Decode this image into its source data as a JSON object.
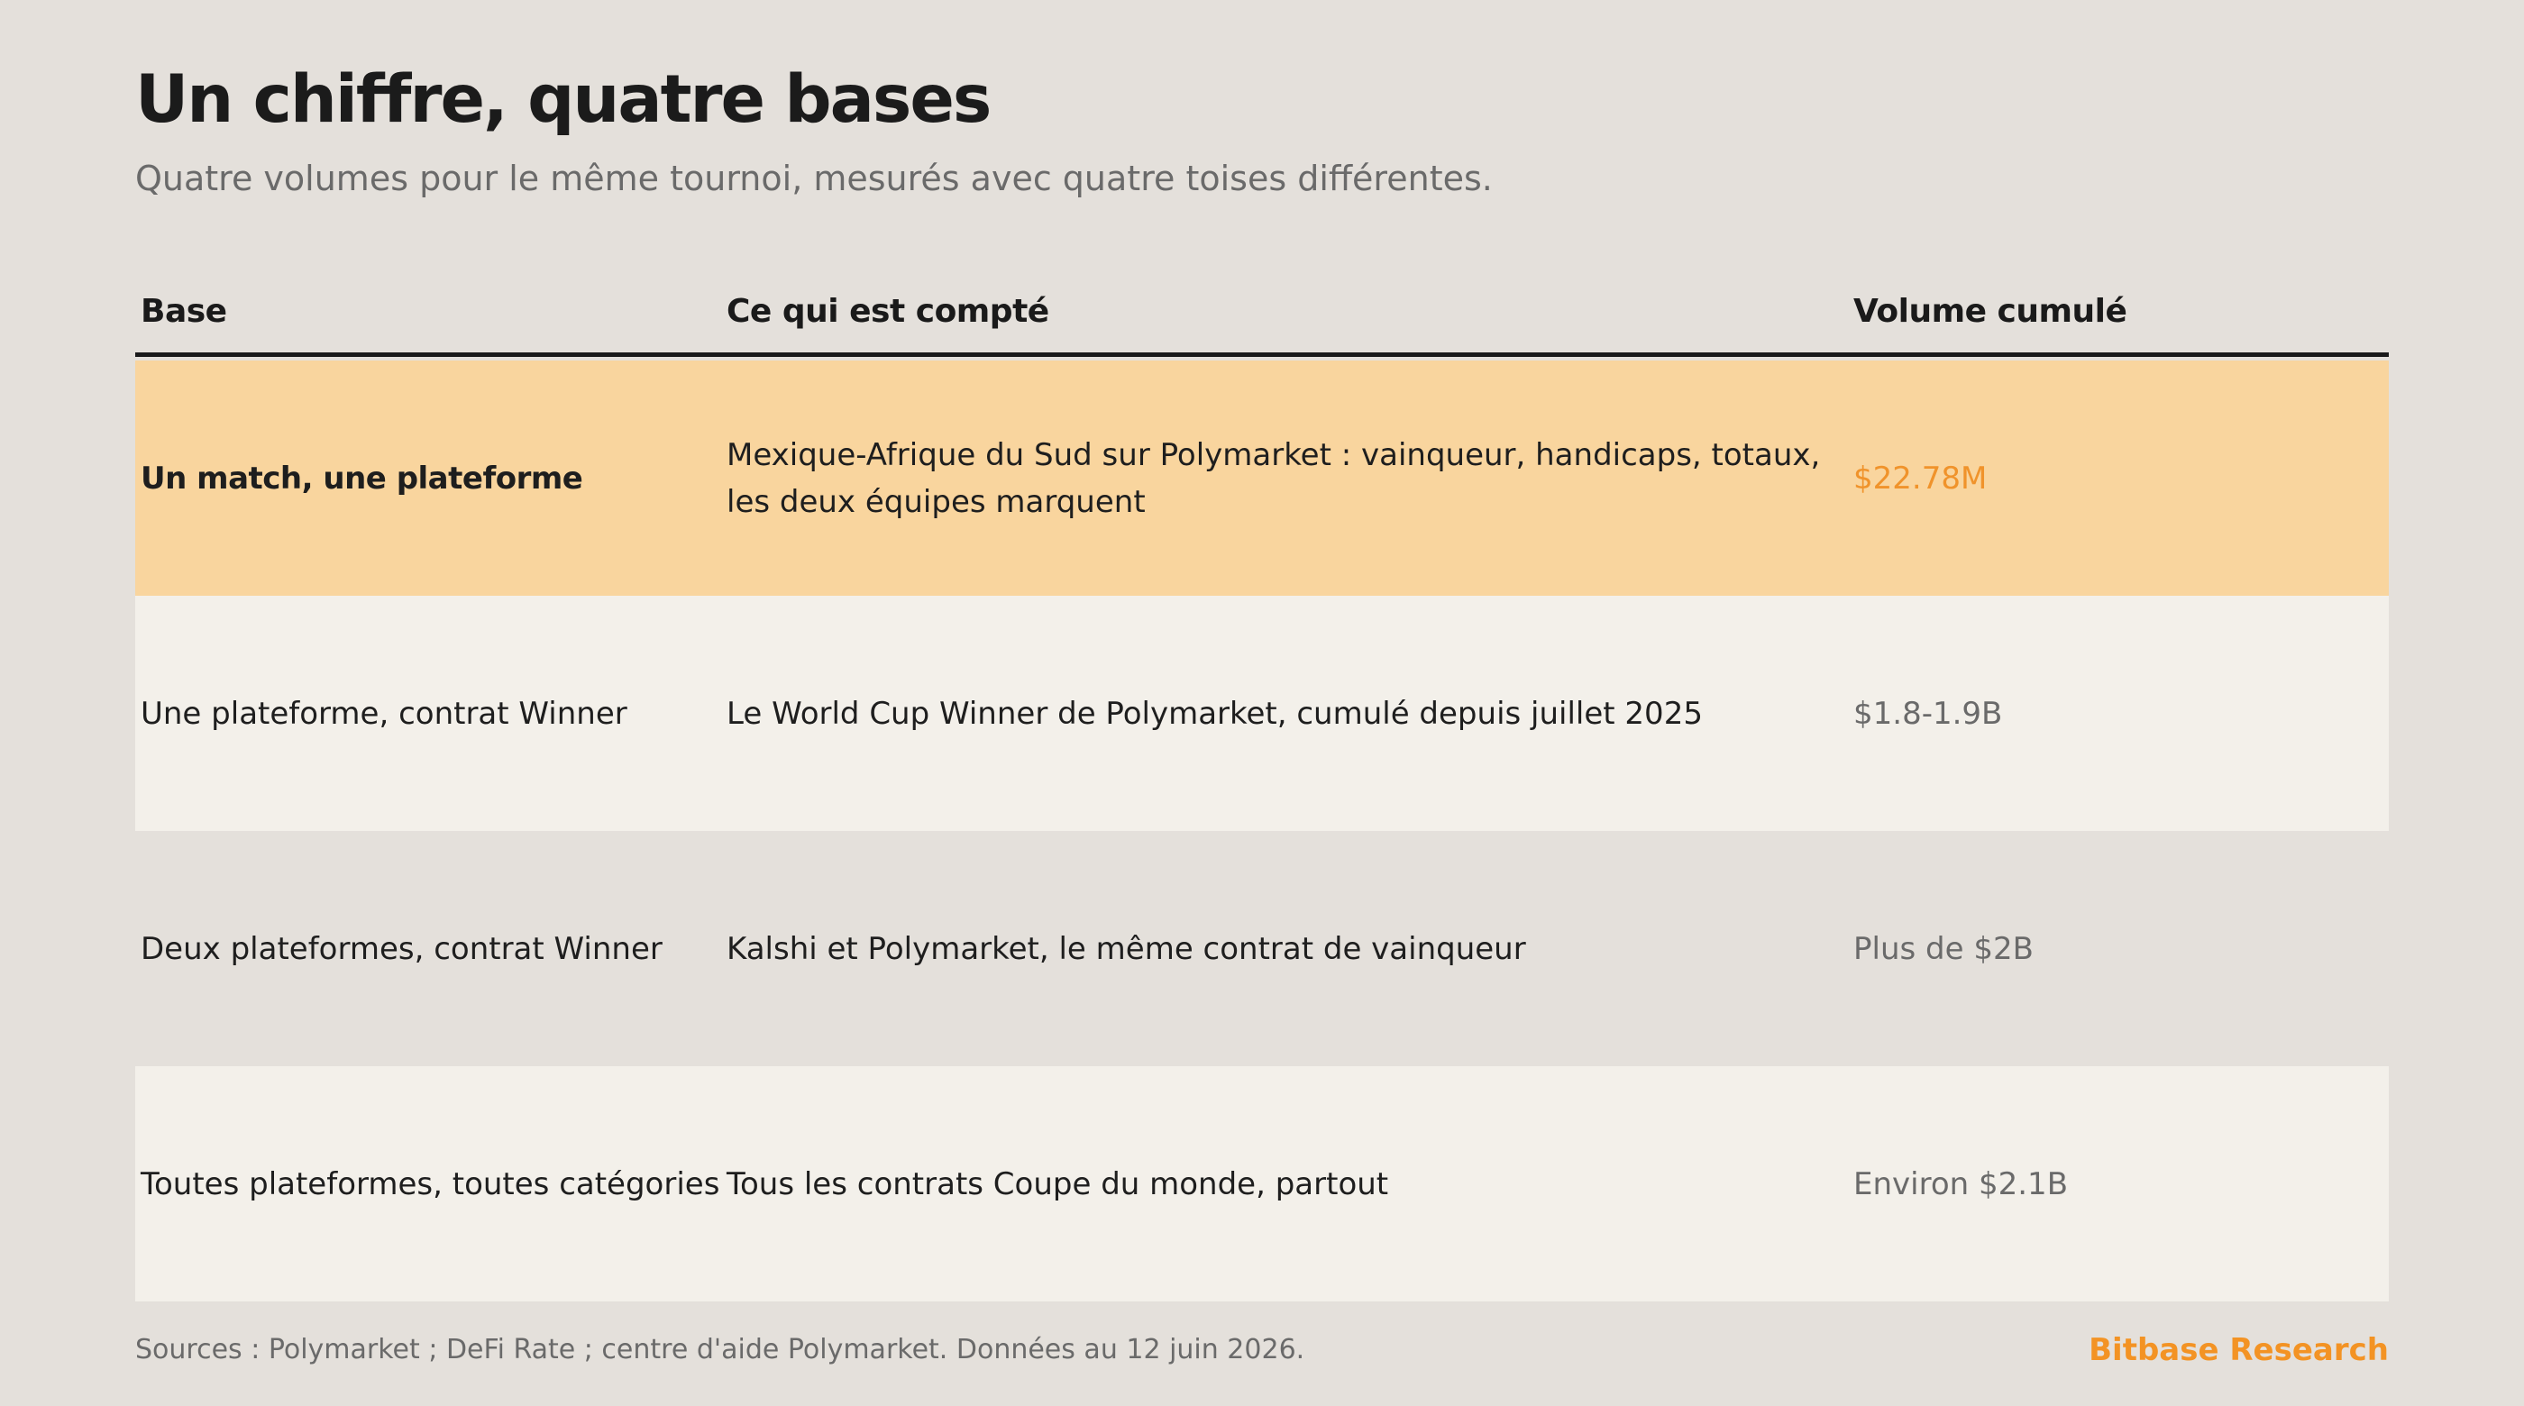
{
  "title": "Un chiffre, quatre bases",
  "subtitle": "Quatre volumes pour le même tournoi, mesurés avec quatre toises différentes.",
  "table": {
    "headers": [
      "Base",
      "Ce qui est compté",
      "Volume cumulé"
    ],
    "rows": [
      {
        "base": "Un match, une plateforme",
        "counted": "Mexique-Afrique du Sud sur Polymarket : vainqueur, handicaps, totaux, les deux équipes marquent",
        "volume": "$22.78M"
      },
      {
        "base": "Une plateforme, contrat Winner",
        "counted": "Le World Cup Winner de Polymarket, cumulé depuis juillet 2025",
        "volume": "$1.8-1.9B"
      },
      {
        "base": "Deux plateformes, contrat Winner",
        "counted": "Kalshi et Polymarket, le même contrat de vainqueur",
        "volume": "Plus de $2B"
      },
      {
        "base": "Toutes plateformes, toutes catégories",
        "counted": "Tous les contrats Coupe du monde, partout",
        "volume": "Environ $2.1B"
      }
    ]
  },
  "footer": {
    "sources": "Sources : Polymarket ; DeFi Rate ; centre d'aide Polymarket. Données au 12 juin 2026.",
    "brand": "Bitbase Research"
  },
  "colors": {
    "background": "#e4e0db",
    "highlight_row": "#f9d59e",
    "light_row": "#f3f0ea",
    "accent": "#f39324"
  }
}
